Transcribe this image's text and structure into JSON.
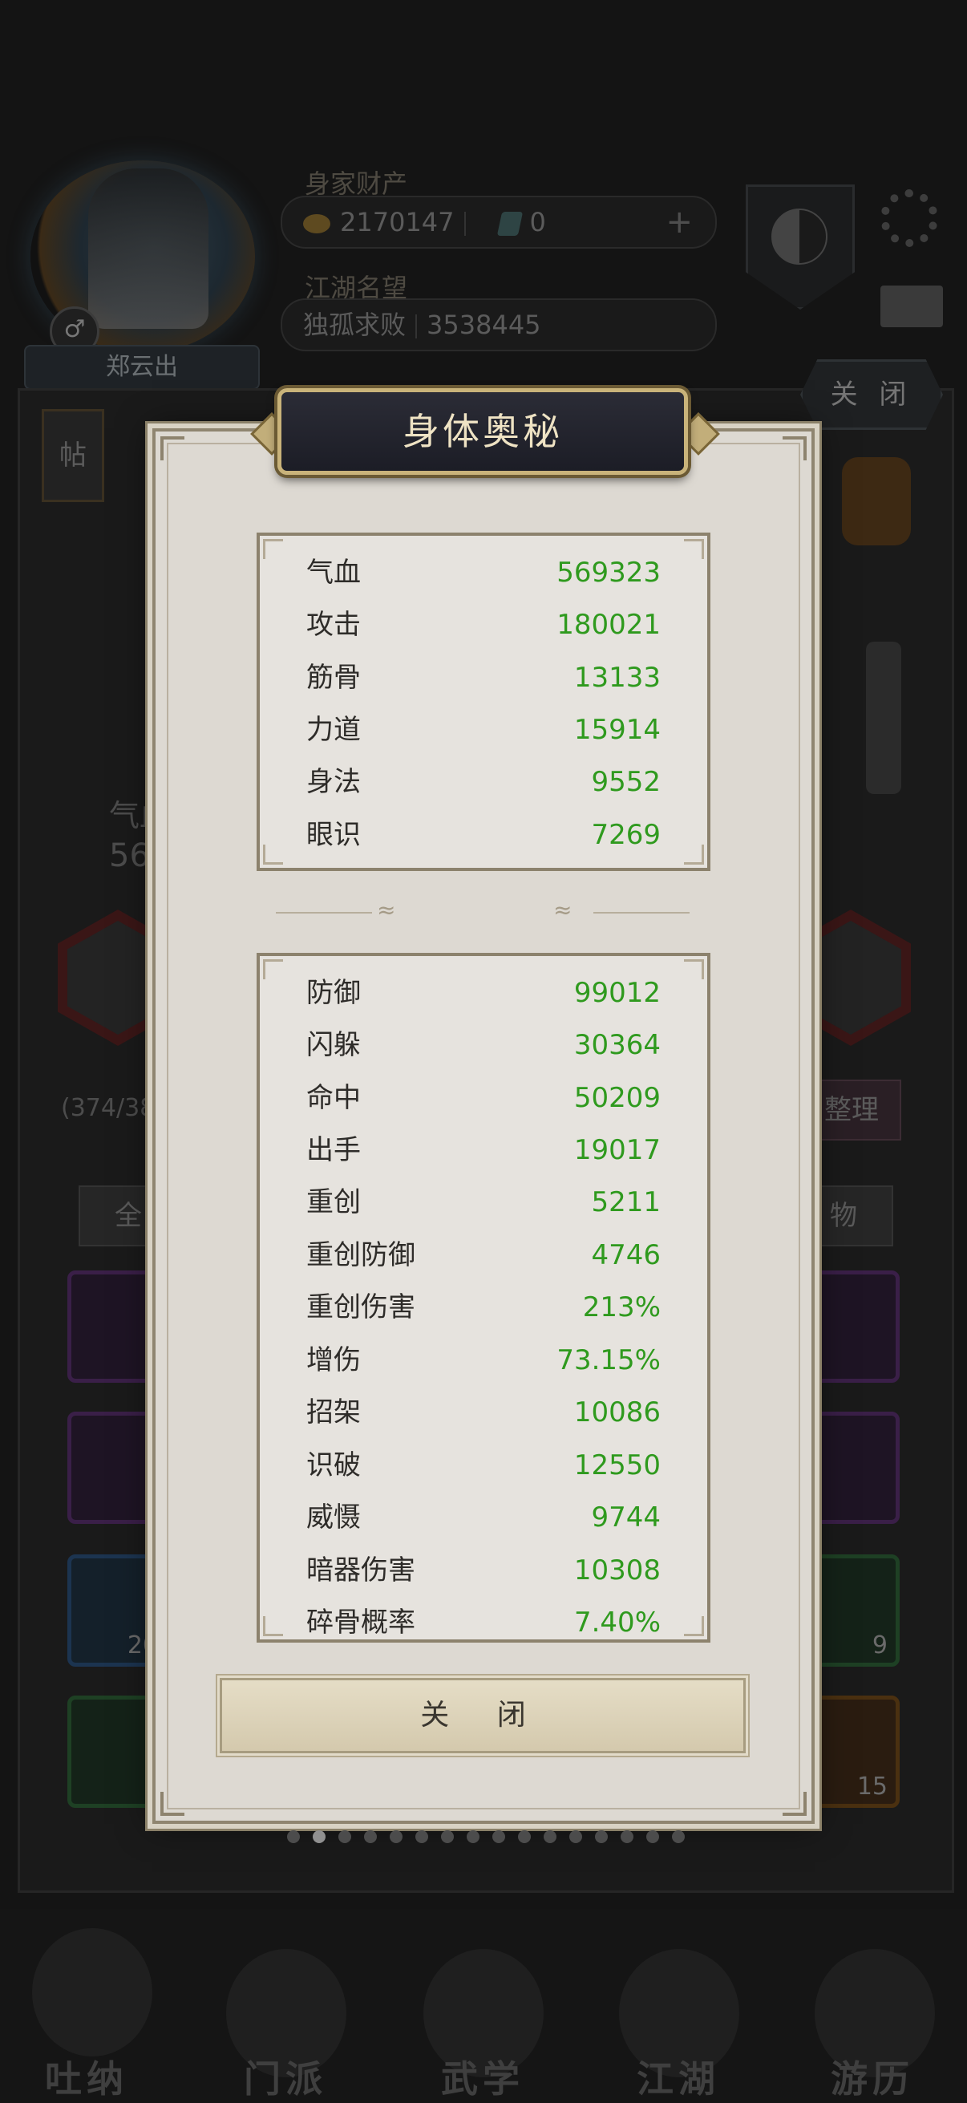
{
  "background": {
    "player_name": "郑云出",
    "wealth_label": "身家财产",
    "gold_amount": "2170147",
    "jade_amount": "0",
    "fame_label": "江湖名望",
    "fame_title": "独孤求败",
    "fame_value": "3538445",
    "top_close_label": "关 闭",
    "tie_label": "帖",
    "qi_label": "气血",
    "qi_value_partial": "569",
    "inventory_count_partial": "(374/38",
    "sort_label": "整理",
    "tab_all_label": "全",
    "tab_item_label": "物",
    "slot_counts": [
      "20",
      "9",
      "15"
    ],
    "nav": [
      "吐纳",
      "门派",
      "武学",
      "江湖",
      "游历"
    ]
  },
  "modal": {
    "title": "身体奥秘",
    "primary_stats": [
      {
        "name": "气血",
        "value": "569323"
      },
      {
        "name": "攻击",
        "value": "180021"
      },
      {
        "name": "筋骨",
        "value": "13133"
      },
      {
        "name": "力道",
        "value": "15914"
      },
      {
        "name": "身法",
        "value": "9552"
      },
      {
        "name": "眼识",
        "value": "7269"
      }
    ],
    "secondary_stats": [
      {
        "name": "防御",
        "value": "99012"
      },
      {
        "name": "闪躲",
        "value": "30364"
      },
      {
        "name": "命中",
        "value": "50209"
      },
      {
        "name": "出手",
        "value": "19017"
      },
      {
        "name": "重创",
        "value": "5211"
      },
      {
        "name": "重创防御",
        "value": "4746"
      },
      {
        "name": "重创伤害",
        "value": "213%"
      },
      {
        "name": "增伤",
        "value": "73.15%"
      },
      {
        "name": "招架",
        "value": "10086"
      },
      {
        "name": "识破",
        "value": "12550"
      },
      {
        "name": "威慑",
        "value": "9744"
      },
      {
        "name": "暗器伤害",
        "value": "10308"
      },
      {
        "name": "碎骨概率",
        "value": "7.40%"
      }
    ],
    "close_label": "关 闭"
  },
  "colors": {
    "stat_value": "#2f9a1e",
    "title_text": "#efe3c4",
    "title_border": "#c9b37a"
  },
  "page_indicator": {
    "total": 16,
    "active": 1
  }
}
